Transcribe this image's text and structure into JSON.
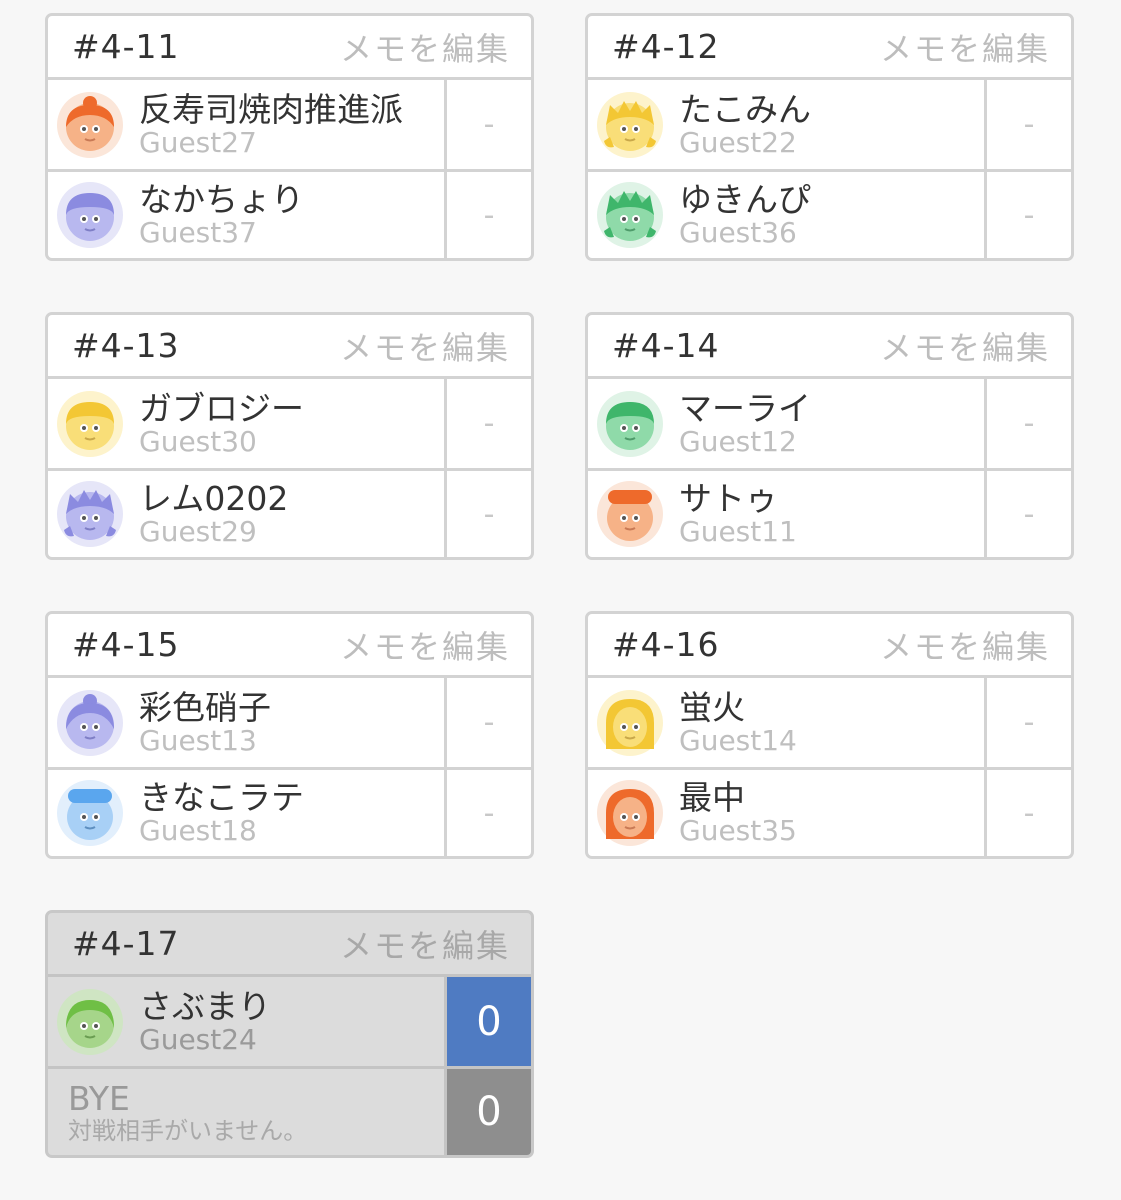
{
  "memo_label": "メモを編集",
  "matches": [
    {
      "id": "#4-11",
      "players": [
        {
          "name": "反寿司焼肉推進派",
          "guest": "Guest27",
          "score": "-",
          "avatar": "orange-bun-girl-icon"
        },
        {
          "name": "なかちょり",
          "guest": "Guest37",
          "score": "-",
          "avatar": "purple-boy-icon"
        }
      ]
    },
    {
      "id": "#4-12",
      "players": [
        {
          "name": "たこみん",
          "guest": "Guest22",
          "score": "-",
          "avatar": "yellow-spiky-icon"
        },
        {
          "name": "ゆきんぴ",
          "guest": "Guest36",
          "score": "-",
          "avatar": "green-spiky-icon"
        }
      ]
    },
    {
      "id": "#4-13",
      "players": [
        {
          "name": "ガブロジー",
          "guest": "Guest30",
          "score": "-",
          "avatar": "yellow-boy-icon"
        },
        {
          "name": "レム0202",
          "guest": "Guest29",
          "score": "-",
          "avatar": "purple-spiky-icon"
        }
      ]
    },
    {
      "id": "#4-14",
      "players": [
        {
          "name": "マーライ",
          "guest": "Guest12",
          "score": "-",
          "avatar": "green-boy-icon"
        },
        {
          "name": "サトゥ",
          "guest": "Guest11",
          "score": "-",
          "avatar": "orange-cap-icon"
        }
      ]
    },
    {
      "id": "#4-15",
      "players": [
        {
          "name": "彩色硝子",
          "guest": "Guest13",
          "score": "-",
          "avatar": "purple-bun-girl-icon"
        },
        {
          "name": "きなこラテ",
          "guest": "Guest18",
          "score": "-",
          "avatar": "blue-cap-icon"
        }
      ]
    },
    {
      "id": "#4-16",
      "players": [
        {
          "name": "蛍火",
          "guest": "Guest14",
          "score": "-",
          "avatar": "yellow-long-hair-icon"
        },
        {
          "name": "最中",
          "guest": "Guest35",
          "score": "-",
          "avatar": "orange-long-hair-icon"
        }
      ]
    },
    {
      "id": "#4-17",
      "players": [
        {
          "name": "さぶまり",
          "guest": "Guest24",
          "score": "0",
          "avatar": "green-girl-icon"
        },
        {
          "name": "BYE",
          "guest": "対戦相手がいません。",
          "score": "0",
          "avatar": ""
        }
      ]
    }
  ],
  "colors": {
    "win_score_bg": "#4f7bc2",
    "bye_score_bg": "#8e8e8e",
    "border": "#d3d3d3",
    "completed_card_bg": "#dcdcdc"
  }
}
